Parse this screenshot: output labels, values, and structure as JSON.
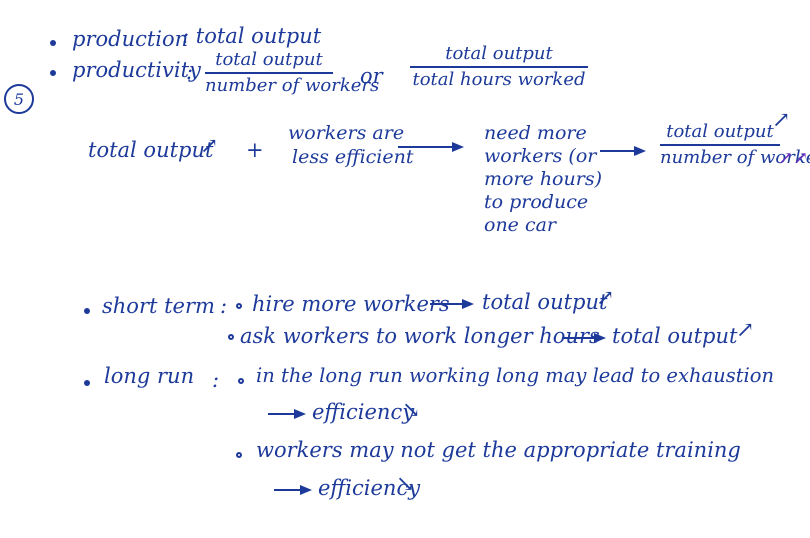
{
  "question_number": "5",
  "definitions": {
    "production_term": "production",
    "production_def": ": total output",
    "productivity_term": "productivity",
    "productivity_colon": ":",
    "frac1_num": "total output",
    "frac1_den": "number of workers",
    "or": "or",
    "frac2_num": "total output",
    "frac2_den": "total hours worked"
  },
  "chain": {
    "step1": "total output",
    "plus": "+",
    "step2_line1": "workers are",
    "step2_line2": "less efficient",
    "step3_lines": [
      "need more",
      "workers (or",
      "more hours)",
      "to produce",
      "one car"
    ],
    "result_num": "total output",
    "result_den": "number of workers"
  },
  "short_term": {
    "label": "short term",
    "colon": ":",
    "item1": "hire more workers",
    "item1_result": "total output",
    "item2": "ask workers to work longer hours",
    "item2_result": "total output"
  },
  "long_run": {
    "label": "long run",
    "colon": ":",
    "item1": "in the long run working long may lead to exhaustion",
    "item1_result": "efficiency",
    "item2": "workers may not get the appropriate training",
    "item2_result": "efficiency"
  },
  "symbols": {
    "up": "↗",
    "down": "↘",
    "double_up": "↗↗"
  },
  "colors": {
    "ink": "#1d3a9a",
    "purple_ink": "#6a2fc0"
  }
}
